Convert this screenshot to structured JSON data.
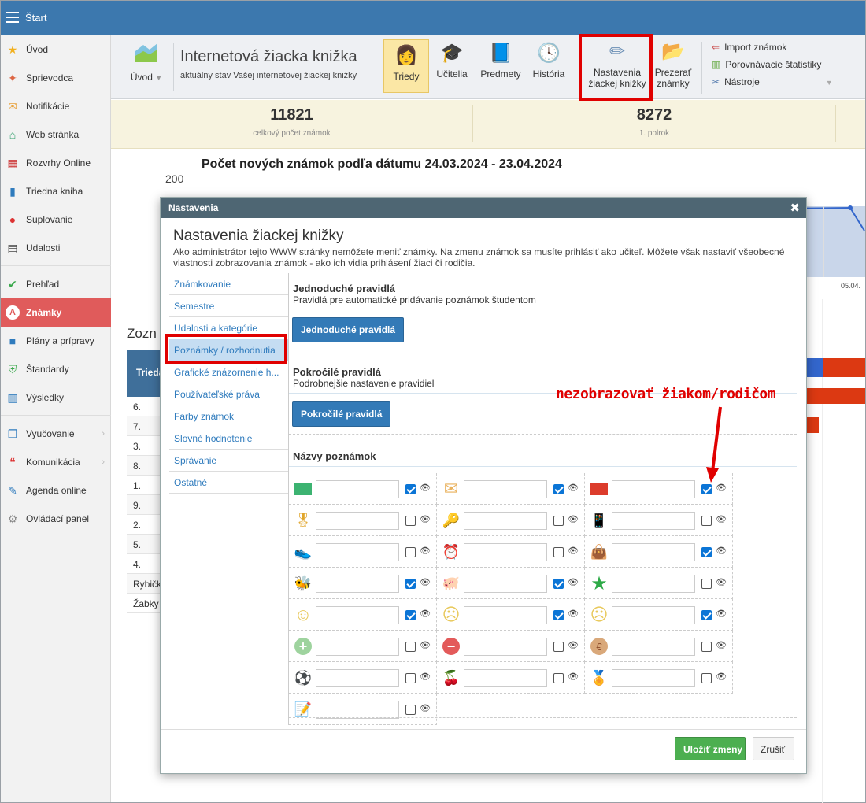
{
  "topbar": {
    "title": "Štart"
  },
  "sidebar": {
    "items": [
      {
        "label": "Úvod",
        "icon": "star-icon"
      },
      {
        "label": "Sprievodca",
        "icon": "wand-icon"
      },
      {
        "label": "Notifikácie",
        "icon": "envelope-icon"
      },
      {
        "label": "Web stránka",
        "icon": "house-icon"
      },
      {
        "label": "Rozvrhy Online",
        "icon": "calendar-grid-icon"
      },
      {
        "label": "Triedna kniha",
        "icon": "book-icon"
      },
      {
        "label": "Suplovanie",
        "icon": "person-icon"
      },
      {
        "label": "Udalosti",
        "icon": "calendar-icon"
      },
      {
        "label": "Prehľad",
        "icon": "check-circle-icon"
      },
      {
        "label": "Známky",
        "icon": "grade-icon"
      },
      {
        "label": "Plány a prípravy",
        "icon": "briefcase-icon"
      },
      {
        "label": "Štandardy",
        "icon": "shield-check-icon"
      },
      {
        "label": "Výsledky",
        "icon": "bar-chart-icon"
      },
      {
        "label": "Vyučovanie",
        "icon": "open-book-icon"
      },
      {
        "label": "Komunikácia",
        "icon": "chat-icon"
      },
      {
        "label": "Agenda online",
        "icon": "pen-icon"
      },
      {
        "label": "Ovládací panel",
        "icon": "gear-icon"
      }
    ]
  },
  "ribbon": {
    "uvod": "Úvod",
    "app_title": "Internetová žiacka knižka",
    "app_subtitle": "aktuálny stav Vašej internetovej žiackej knižky",
    "triedy": "Triedy",
    "ucitelia": "Učitelia",
    "predmety": "Predmety",
    "historia": "História",
    "nastavenia_l1": "Nastavenia",
    "nastavenia_l2": "žiackej knižky",
    "prezerat_l1": "Prezerať",
    "prezerat_l2": "známky",
    "import": "Import známok",
    "porovnavacie": "Porovnávacie štatistiky",
    "nastroje": "Nástroje"
  },
  "stats": [
    {
      "value": "11821",
      "label": "celkový počet známok"
    },
    {
      "value": "8272",
      "label": "1. polrok"
    }
  ],
  "chart": {
    "title": "Počet nových známok podľa dátumu 24.03.2024 - 23.04.2024",
    "ytick": "200",
    "xtick": "05.04."
  },
  "background": {
    "list_title": "Zozn",
    "table_header": "Trieda",
    "rows": [
      "6.",
      "7.",
      "3.",
      "8.",
      "1.",
      "9.",
      "2.",
      "5.",
      "4.",
      "Rybičk",
      "Žabky"
    ]
  },
  "modal": {
    "header": "Nastavenia",
    "title": "Nastavenia žiackej knižky",
    "description": "Ako administrátor tejto WWW stránky nemôžete meniť známky. Na zmenu známok sa musíte prihlásiť ako učiteľ. Môžete však nastaviť všeobecné vlastnosti zobrazovania známok - ako ich vidia prihlásení žiaci či rodičia.",
    "nav": [
      "Známkovanie",
      "Semestre",
      "Udalosti a kategórie",
      "Poznámky / rozhodnutia",
      "Grafické znázornenie h...",
      "Používateľské práva",
      "Farby známok",
      "Slovné hodnotenie",
      "Správanie",
      "Ostatné"
    ],
    "simple": {
      "title": "Jednoduché pravidlá",
      "subtitle": "Pravidlá pre automatické pridávanie poznámok študentom",
      "button": "Jednoduché pravidlá"
    },
    "advanced": {
      "title": "Pokročilé pravidlá",
      "subtitle": "Podrobnejšie nastavenie pravidiel",
      "button": "Pokročilé pravidlá"
    },
    "names_title": "Názvy poznámok",
    "notes": [
      {
        "icon": "green-square-icon",
        "checked": true
      },
      {
        "icon": "envelope-icon",
        "checked": true
      },
      {
        "icon": "red-square-icon",
        "checked": true
      },
      {
        "icon": "medal-star-icon",
        "checked": false
      },
      {
        "icon": "key-icon",
        "checked": false
      },
      {
        "icon": "phone-icon",
        "checked": false
      },
      {
        "icon": "shoe-icon",
        "checked": false
      },
      {
        "icon": "alarm-clock-icon",
        "checked": false
      },
      {
        "icon": "handbag-icon",
        "checked": true
      },
      {
        "icon": "bee-icon",
        "checked": true
      },
      {
        "icon": "piggy-bank-icon",
        "checked": true
      },
      {
        "icon": "green-star-icon",
        "checked": false
      },
      {
        "icon": "smiley-icon",
        "checked": true
      },
      {
        "icon": "neutral-face-icon",
        "checked": true
      },
      {
        "icon": "sad-face-icon",
        "checked": true
      },
      {
        "icon": "plus-circle-icon",
        "checked": false
      },
      {
        "icon": "minus-circle-icon",
        "checked": false
      },
      {
        "icon": "euro-coin-icon",
        "checked": false
      },
      {
        "icon": "soccer-ball-icon",
        "checked": false
      },
      {
        "icon": "cherries-icon",
        "checked": false
      },
      {
        "icon": "gold-medal-icon",
        "checked": false
      },
      {
        "icon": "note-edit-icon",
        "checked": false
      }
    ],
    "save": "Uložiť zmeny",
    "cancel": "Zrušiť"
  },
  "annotation": "nezobrazovať žiakom/rodičom",
  "colors": {
    "accent_blue": "#3c78ae",
    "active_red": "#e05b5b",
    "highlight_red": "#e00000",
    "save_green": "#4caf50"
  }
}
